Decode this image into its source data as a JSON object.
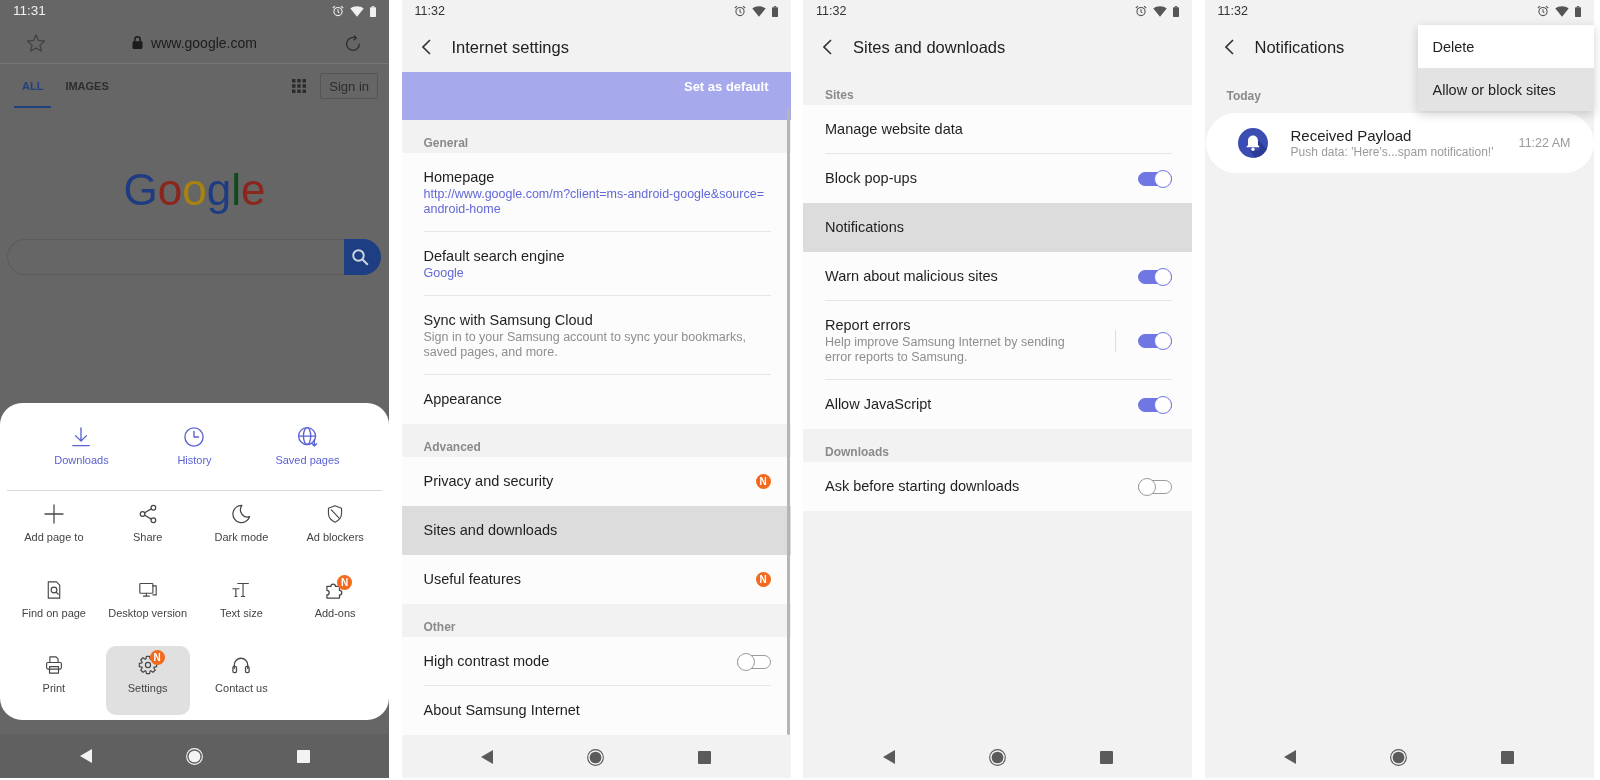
{
  "browser_screen": {
    "status_bar": {
      "time": "11:31"
    },
    "address_bar": {
      "url": "www.google.com"
    },
    "tabs": [
      {
        "label": "ALL",
        "selected": true
      },
      {
        "label": "IMAGES",
        "selected": false
      }
    ],
    "sign_in_button": "Sign in",
    "logo": "Google",
    "menu": {
      "shortcuts": [
        "Downloads",
        "History",
        "Saved pages"
      ],
      "items": [
        {
          "label": "Add page to",
          "selected": false
        },
        {
          "label": "Share",
          "selected": false
        },
        {
          "label": "Dark mode",
          "selected": false
        },
        {
          "label": "Ad blockers",
          "selected": false
        },
        {
          "label": "Find on page",
          "selected": false
        },
        {
          "label": "Desktop version",
          "selected": false
        },
        {
          "label": "Text size",
          "selected": false
        },
        {
          "label": "Add-ons",
          "badge": "N",
          "selected": false
        },
        {
          "label": "Print",
          "selected": false
        },
        {
          "label": "Settings",
          "badge": "N",
          "selected": true
        },
        {
          "label": "Contact us",
          "selected": false
        }
      ]
    }
  },
  "internet_settings_screen": {
    "status_bar": {
      "time": "11:32"
    },
    "title": "Internet settings",
    "banner": {
      "button": "Set as default"
    },
    "sections": [
      {
        "header": "General",
        "rows": [
          {
            "kind": "link",
            "title": "Homepage",
            "value": "http://www.google.com/m?client=ms-android-google&source=android-home",
            "selected": false
          },
          {
            "kind": "link",
            "title": "Default search engine",
            "value": "Google",
            "selected": false
          },
          {
            "kind": "link",
            "title": "Sync with Samsung Cloud",
            "description": "Sign in to your Samsung account to sync your bookmarks, saved pages, and more.",
            "selected": false
          },
          {
            "kind": "link",
            "title": "Appearance",
            "selected": false
          }
        ]
      },
      {
        "header": "Advanced",
        "rows": [
          {
            "kind": "link",
            "title": "Privacy and security",
            "badge": "N",
            "selected": false
          },
          {
            "kind": "link",
            "title": "Sites and downloads",
            "selected": true
          },
          {
            "kind": "link",
            "title": "Useful features",
            "badge": "N",
            "selected": false
          }
        ]
      },
      {
        "header": "Other",
        "rows": [
          {
            "kind": "toggle",
            "title": "High contrast mode",
            "on": false,
            "selected": false
          },
          {
            "kind": "link",
            "title": "About Samsung Internet",
            "selected": false
          }
        ]
      }
    ]
  },
  "sites_and_downloads_screen": {
    "status_bar": {
      "time": "11:32"
    },
    "title": "Sites and downloads",
    "sections": [
      {
        "header": "Sites",
        "rows": [
          {
            "kind": "link",
            "title": "Manage website data",
            "selected": false
          },
          {
            "kind": "toggle",
            "title": "Block pop-ups",
            "on": true,
            "selected": false
          },
          {
            "kind": "link",
            "title": "Notifications",
            "selected": true
          },
          {
            "kind": "toggle",
            "title": "Warn about malicious sites",
            "on": true,
            "selected": false
          },
          {
            "kind": "toggle",
            "title": "Report errors",
            "description": "Help improve Samsung Internet by sending error reports to Samsung.",
            "on": true,
            "selected": false
          },
          {
            "kind": "toggle",
            "title": "Allow JavaScript",
            "on": true,
            "selected": false
          }
        ]
      },
      {
        "header": "Downloads",
        "rows": [
          {
            "kind": "toggle",
            "title": "Ask before starting downloads",
            "on": false,
            "selected": false
          }
        ]
      }
    ]
  },
  "notifications_screen": {
    "status_bar": {
      "time": "11:32"
    },
    "title": "Notifications",
    "menu": [
      {
        "label": "Delete",
        "selected": false
      },
      {
        "label": "Allow or block sites",
        "selected": true
      }
    ],
    "groups": [
      {
        "header": "Today",
        "items": [
          {
            "title": "Received Payload",
            "body": "Push data: 'Here's...spam notification!'",
            "time": "11:22 AM"
          }
        ]
      }
    ]
  }
}
